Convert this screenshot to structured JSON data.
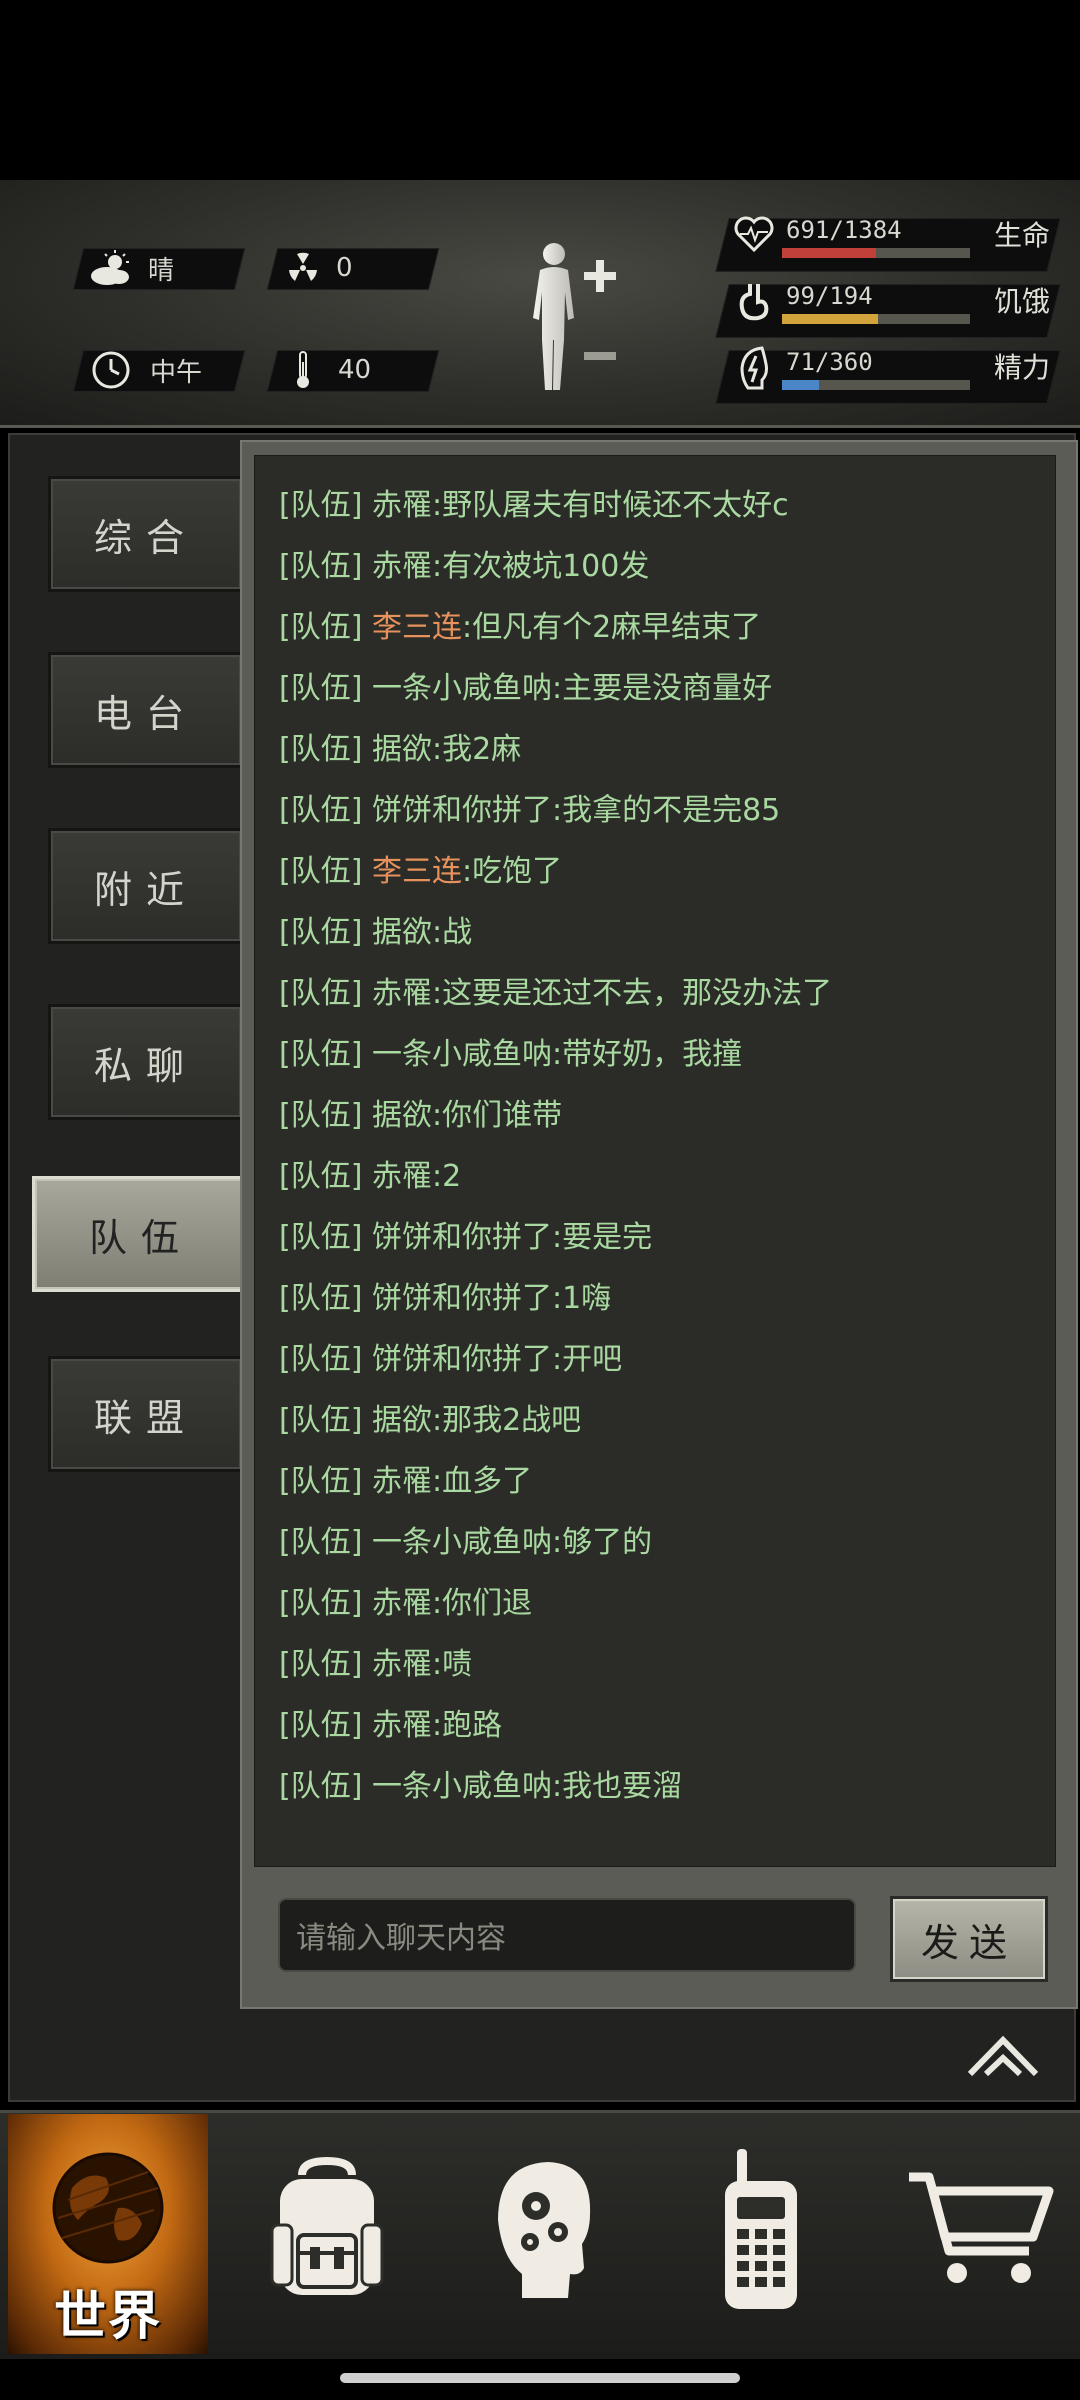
{
  "hud": {
    "weather": {
      "icon": "cloud-sun-icon",
      "label": "晴"
    },
    "radiation": {
      "icon": "radiation-icon",
      "value": "0"
    },
    "time": {
      "icon": "clock-icon",
      "label": "中午"
    },
    "temperature": {
      "icon": "thermometer-icon",
      "value": "40"
    },
    "stats": [
      {
        "name": "health",
        "icon": "heart-icon",
        "value": "691/1384",
        "label": "生命",
        "fraction": 0.4993,
        "color": "#c2403a"
      },
      {
        "name": "hunger",
        "icon": "stomach-icon",
        "value": "99/194",
        "label": "饥饿",
        "fraction": 0.51,
        "color": "#d4a43c"
      },
      {
        "name": "energy",
        "icon": "energy-icon",
        "value": "71/360",
        "label": "精力",
        "fraction": 0.197,
        "color": "#4a86c8"
      }
    ]
  },
  "sidebar": {
    "tabs": [
      {
        "label": "综合",
        "active": false
      },
      {
        "label": "电台",
        "active": false
      },
      {
        "label": "附近",
        "active": false
      },
      {
        "label": "私聊",
        "active": false
      },
      {
        "label": "队伍",
        "active": true
      },
      {
        "label": "联盟",
        "active": false
      }
    ]
  },
  "chat": {
    "messages": [
      {
        "channel": "[队伍]",
        "name": "赤罹",
        "text": ":野队屠夫有时候还不太好c",
        "highlight": false
      },
      {
        "channel": "[队伍]",
        "name": "赤罹",
        "text": ":有次被坑100发",
        "highlight": false
      },
      {
        "channel": "[队伍]",
        "name": "李三连",
        "text": ":但凡有个2麻早结束了",
        "highlight": true
      },
      {
        "channel": "[队伍]",
        "name": "一条小咸鱼呐",
        "text": ":主要是没商量好",
        "highlight": false
      },
      {
        "channel": "[队伍]",
        "name": "据欲",
        "text": ":我2麻",
        "highlight": false
      },
      {
        "channel": "[队伍]",
        "name": "饼饼和你拼了",
        "text": ":我拿的不是完85",
        "highlight": false
      },
      {
        "channel": "[队伍]",
        "name": "李三连",
        "text": ":吃饱了",
        "highlight": true
      },
      {
        "channel": "[队伍]",
        "name": "据欲",
        "text": ":战",
        "highlight": false
      },
      {
        "channel": "[队伍]",
        "name": "赤罹",
        "text": ":这要是还过不去，那没办法了",
        "highlight": false
      },
      {
        "channel": "[队伍]",
        "name": "一条小咸鱼呐",
        "text": ":带好奶，我撞",
        "highlight": false
      },
      {
        "channel": "[队伍]",
        "name": "据欲",
        "text": ":你们谁带",
        "highlight": false
      },
      {
        "channel": "[队伍]",
        "name": "赤罹",
        "text": ":2",
        "highlight": false
      },
      {
        "channel": "[队伍]",
        "name": "饼饼和你拼了",
        "text": ":要是完",
        "highlight": false
      },
      {
        "channel": "[队伍]",
        "name": "饼饼和你拼了",
        "text": ":1嗨",
        "highlight": false
      },
      {
        "channel": "[队伍]",
        "name": "饼饼和你拼了",
        "text": ":开吧",
        "highlight": false
      },
      {
        "channel": "[队伍]",
        "name": "据欲",
        "text": ":那我2战吧",
        "highlight": false
      },
      {
        "channel": "[队伍]",
        "name": "赤罹",
        "text": ":血多了",
        "highlight": false
      },
      {
        "channel": "[队伍]",
        "name": "一条小咸鱼呐",
        "text": ":够了的",
        "highlight": false
      },
      {
        "channel": "[队伍]",
        "name": "赤罹",
        "text": ":你们退",
        "highlight": false
      },
      {
        "channel": "[队伍]",
        "name": "赤罹",
        "text": ":啧",
        "highlight": false
      },
      {
        "channel": "[队伍]",
        "name": "赤罹",
        "text": ":跑路",
        "highlight": false
      },
      {
        "channel": "[队伍]",
        "name": "一条小咸鱼呐",
        "text": ":我也要溜",
        "highlight": false
      }
    ],
    "input_placeholder": "请输入聊天内容",
    "send_label": "发送",
    "highlight_color": "#e7925c",
    "text_color": "#a9d9a1"
  },
  "bottom_nav": {
    "world_label": "世界",
    "items": [
      {
        "name": "world",
        "icon": "globe-icon",
        "active": true
      },
      {
        "name": "backpack",
        "icon": "backpack-icon",
        "active": false
      },
      {
        "name": "skills",
        "icon": "head-gears-icon",
        "active": false
      },
      {
        "name": "radio",
        "icon": "walkie-talkie-icon",
        "active": false
      },
      {
        "name": "shop",
        "icon": "cart-icon",
        "active": false
      }
    ]
  }
}
